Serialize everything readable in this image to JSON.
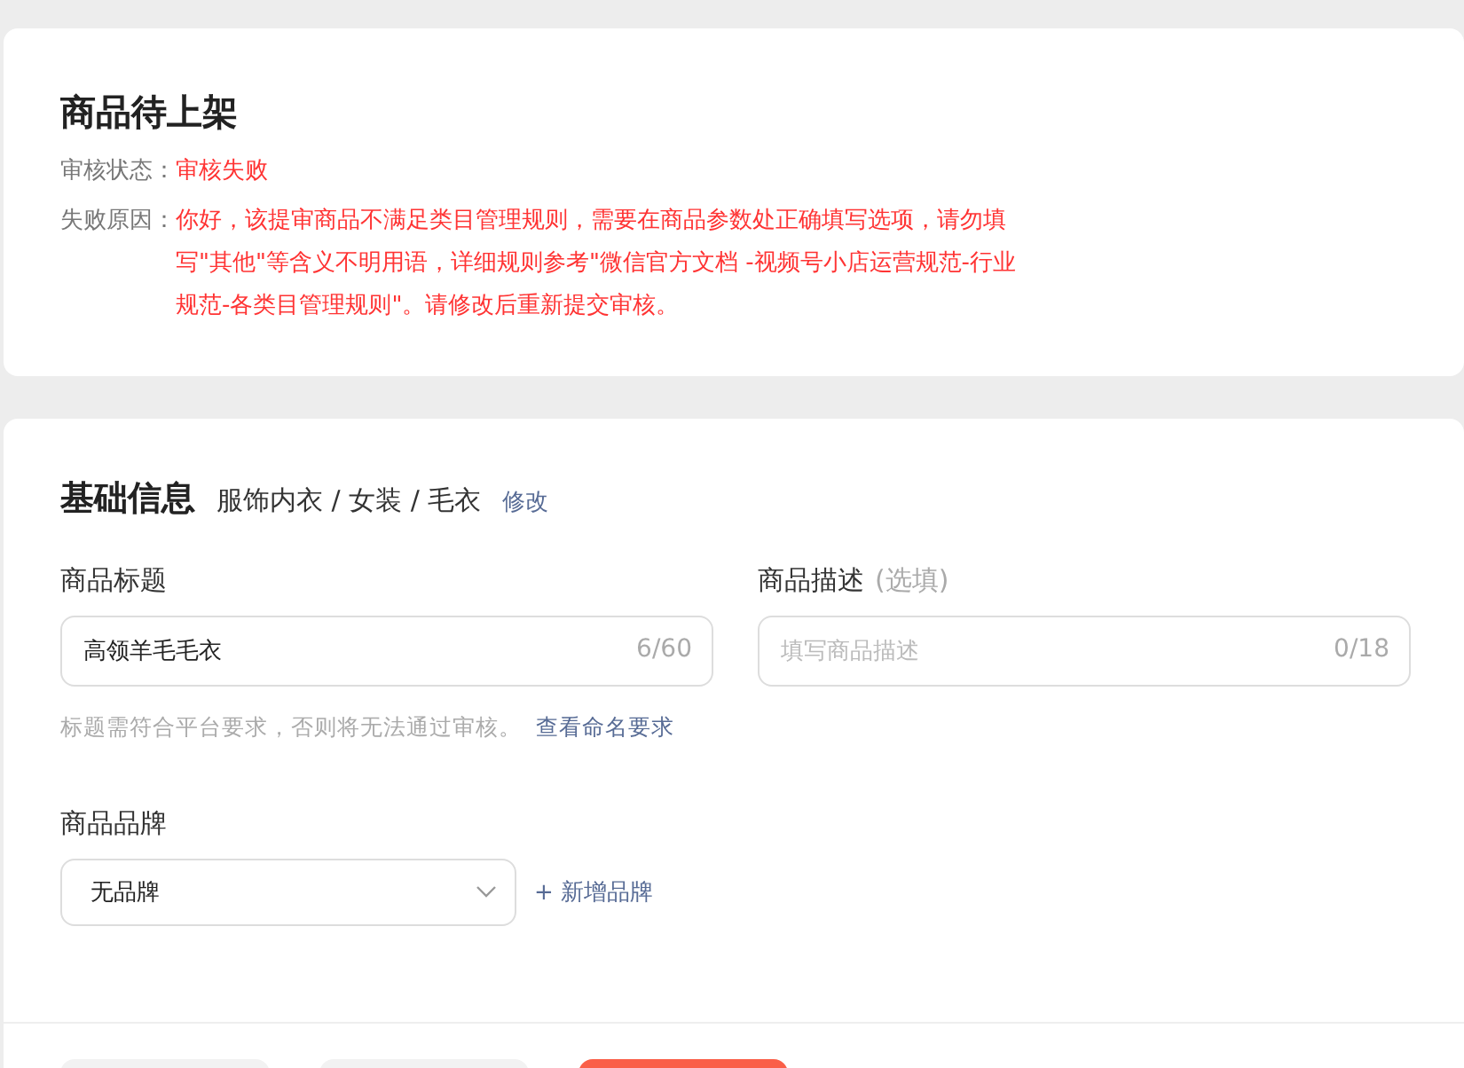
{
  "status_card": {
    "title": "商品待上架",
    "fields": [
      {
        "label": "审核状态：",
        "value": "审核失败"
      },
      {
        "label": "失败原因：",
        "value": "你好，该提审商品不满足类目管理规则，需要在商品参数处正确填写选项，请勿填写\"其他\"等含义不明用语，详细规则参考\"微信官方文档 -视频号小店运营规范-行业规范-各类目管理规则\"。请修改后重新提交审核。"
      }
    ]
  },
  "basic_info": {
    "title": "基础信息",
    "category": "服饰内衣 / 女装 / 毛衣",
    "edit_link": "修改",
    "fields": [
      {
        "label": "商品标题",
        "value": "高领羊毛毛衣",
        "counter": "6/60",
        "hint": "标题需符合平台要求，否则将无法通过审核。",
        "hint_link": "查看命名要求"
      },
      {
        "label": "商品描述",
        "optional": "(选填)",
        "placeholder": "填写商品描述",
        "counter": "0/18"
      }
    ],
    "brand": {
      "label": "商品品牌",
      "value": "无品牌",
      "add_link": "+ 新增品牌"
    }
  },
  "footer": {
    "buttons": [
      {
        "kind": "secondary"
      },
      {
        "kind": "secondary"
      },
      {
        "kind": "primary"
      }
    ]
  }
}
